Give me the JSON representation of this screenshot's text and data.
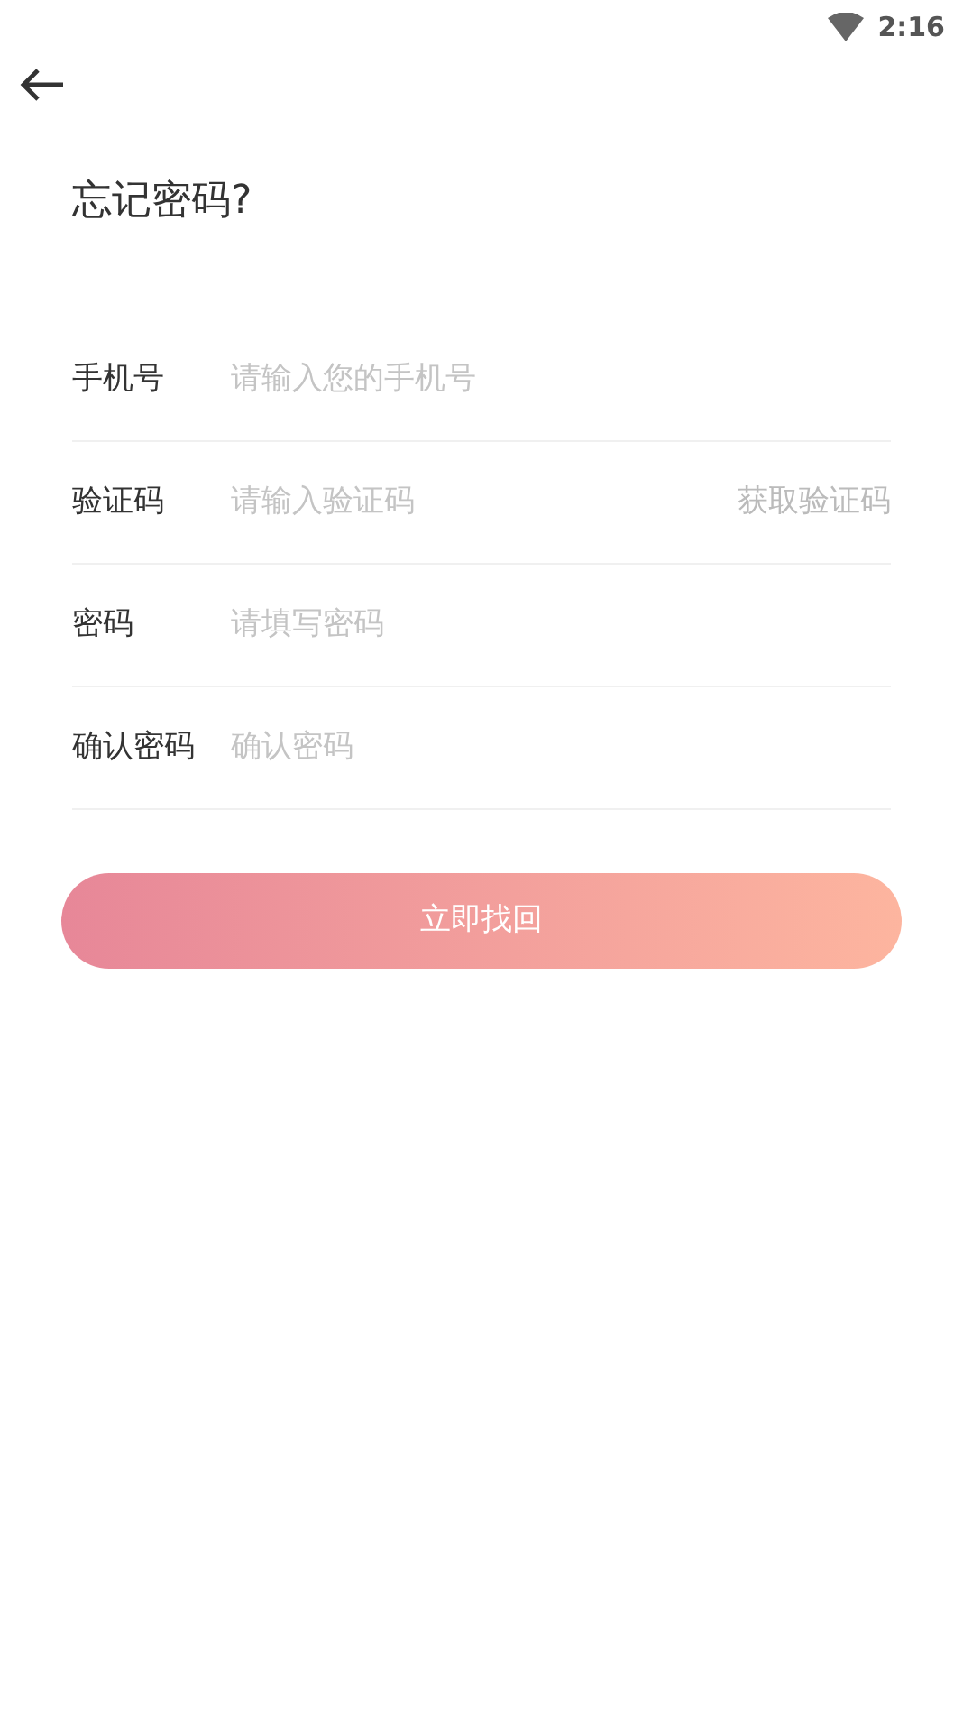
{
  "status_bar": {
    "time": "2:16"
  },
  "title": "忘记密码?",
  "fields": [
    {
      "label": "手机号",
      "placeholder": "请输入您的手机号"
    },
    {
      "label": "验证码",
      "placeholder": "请输入验证码",
      "action": "获取验证码"
    },
    {
      "label": "密码",
      "placeholder": "请填写密码"
    },
    {
      "label": "确认密码",
      "placeholder": "确认密码"
    }
  ],
  "submit_button": "立即找回"
}
